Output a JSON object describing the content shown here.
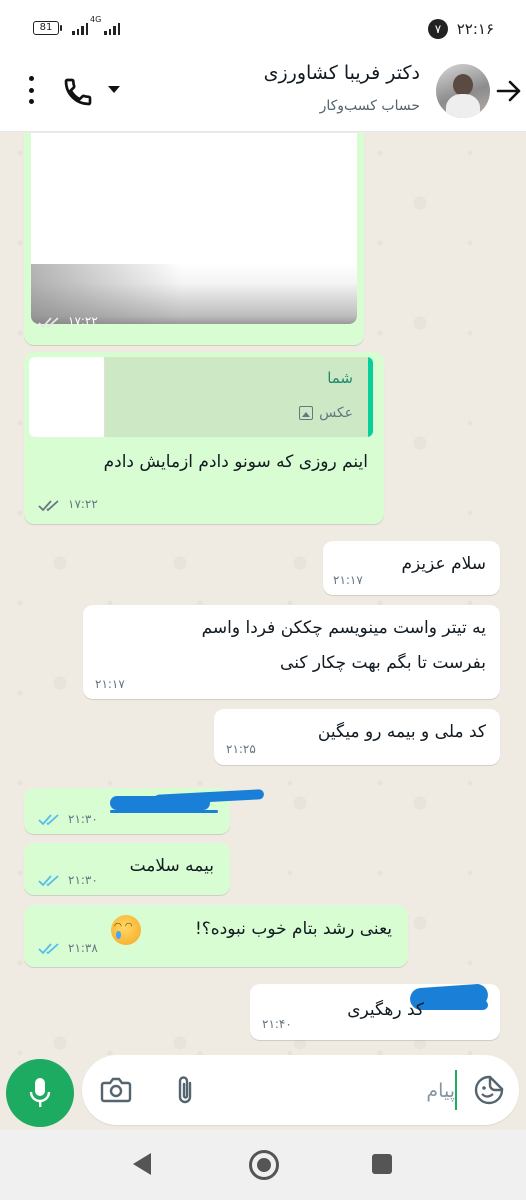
{
  "status_bar": {
    "battery": "81",
    "network": "4G",
    "time": "۲۲:۱۶",
    "notification_count": "۷"
  },
  "header": {
    "contact_name": "دکتر فریبا کشاورزی",
    "subtitle": "حساب کسب‌وکار"
  },
  "messages": [
    {
      "direction": "out",
      "type": "image",
      "time": "۱۷:۲۲",
      "status": "read"
    },
    {
      "direction": "out",
      "type": "reply",
      "reply_to_name": "شما",
      "reply_to_type": "عکس",
      "text": "اینم روزی که سونو دادم ازمایش دادم",
      "time": "۱۷:۲۲",
      "status": "read"
    },
    {
      "direction": "in",
      "text": "سلام عزیزم",
      "time": "۲۱:۱۷"
    },
    {
      "direction": "in",
      "text_line1": "یه تیتر واست مینویسم چککن فردا واسم",
      "text_line2": "بفرست تا بگم بهت چکار کنی",
      "time": "۲۱:۱۷"
    },
    {
      "direction": "in",
      "text": "کد ملی و بیمه رو میگین",
      "time": "۲۱:۲۵"
    },
    {
      "direction": "out",
      "type": "redacted",
      "time": "۲۱:۳۰",
      "status": "read"
    },
    {
      "direction": "out",
      "text": "بیمه سلامت",
      "time": "۲۱:۳۰",
      "status": "read"
    },
    {
      "direction": "out",
      "text": "یعنی رشد بتام خوب نبوده؟!",
      "emoji": "crying-face",
      "time": "۲۱:۳۸",
      "status": "read"
    },
    {
      "direction": "in",
      "text": "کد رهگیری",
      "time": "۲۱:۴۰"
    }
  ],
  "input": {
    "placeholder": "پیام"
  },
  "colors": {
    "outgoing_bubble": "#d9fdd3",
    "incoming_bubble": "#ffffff",
    "accent_green": "#1daa61",
    "read_ticks": "#53bdeb"
  }
}
